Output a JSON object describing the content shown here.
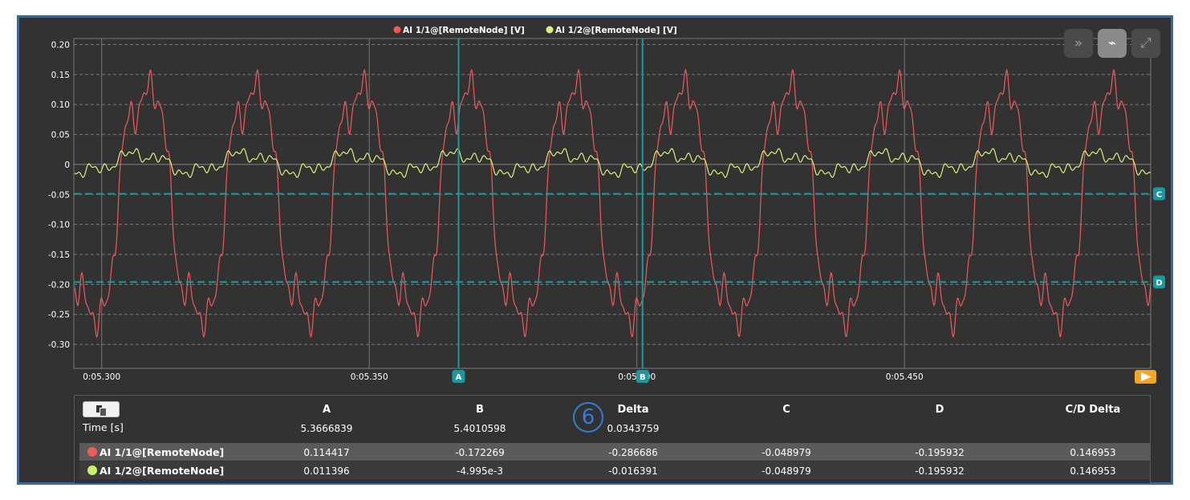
{
  "chart_data": {
    "type": "line",
    "legend": [
      {
        "name": "AI 1/1@[RemoteNode] [V]",
        "color": "#ee5a5a"
      },
      {
        "name": "AI 1/2@[RemoteNode] [V]",
        "color": "#d8f27a"
      }
    ],
    "legend_placement": "top-center",
    "x_range": [
      5.2948,
      5.496
    ],
    "x_ticks": [
      {
        "v": 5.3,
        "label": "0:05.300"
      },
      {
        "v": 5.35,
        "label": "0:05.350"
      },
      {
        "v": 5.4,
        "label": "0:05.400"
      },
      {
        "v": 5.45,
        "label": "0:05.450"
      }
    ],
    "y_range": [
      -0.34,
      0.21
    ],
    "y_ticks": [
      {
        "v": 0.2,
        "label": "0.20"
      },
      {
        "v": 0.15,
        "label": "0.15"
      },
      {
        "v": 0.1,
        "label": "0.10"
      },
      {
        "v": 0.05,
        "label": "0.05"
      },
      {
        "v": 0.0,
        "label": "0"
      },
      {
        "v": -0.05,
        "label": "-0.05"
      },
      {
        "v": -0.1,
        "label": "-0.10"
      },
      {
        "v": -0.15,
        "label": "-0.15"
      },
      {
        "v": -0.2,
        "label": "-0.20"
      },
      {
        "v": -0.25,
        "label": "-0.25"
      },
      {
        "v": -0.3,
        "label": "-0.30"
      }
    ],
    "grid": true,
    "signal_period_s": 0.02,
    "series": [
      {
        "name": "AI 1/1@[RemoteNode]",
        "color": "#ee5a5a",
        "max": 0.205,
        "min": -0.335
      },
      {
        "name": "AI 1/2@[RemoteNode]",
        "color": "#d8f27a",
        "max": 0.03,
        "min": -0.025
      }
    ],
    "cursors": {
      "vertical": [
        {
          "label": "A",
          "x": 5.3666839
        },
        {
          "label": "B",
          "x": 5.4010598
        }
      ],
      "horizontal": [
        {
          "label": "C",
          "y": -0.048979
        },
        {
          "label": "D",
          "y": -0.195932
        }
      ],
      "color": "#1a9aa0"
    }
  },
  "toolbar": [
    {
      "icon": "fast-forward-icon",
      "glyph": "»",
      "active": false
    },
    {
      "icon": "cursor-tool-icon",
      "glyph": "⌁",
      "active": true
    },
    {
      "icon": "expand-icon",
      "glyph": "⤢",
      "active": false
    }
  ],
  "table": {
    "headers": {
      "a": "A",
      "b": "B",
      "delta": "Delta",
      "c": "C",
      "d": "D",
      "cd_delta": "C/D Delta"
    },
    "time_label": "Time [s]",
    "time": {
      "a": "5.3666839",
      "b": "5.4010598",
      "delta": "0.0343759"
    },
    "rows": [
      {
        "label": "AI 1/1@[RemoteNode]",
        "color": "#ee5a5a",
        "a": "0.114417",
        "b": "-0.172269",
        "delta": "-0.286686",
        "c": "-0.048979",
        "d": "-0.195932",
        "cd_delta": "0.146953"
      },
      {
        "label": "AI 1/2@[RemoteNode]",
        "color": "#c8f06a",
        "a": "0.011396",
        "b": "-4.995e-3",
        "delta": "-0.016391",
        "c": "-0.048979",
        "d": "-0.195932",
        "cd_delta": "0.146953"
      }
    ],
    "step_badge": "6"
  }
}
